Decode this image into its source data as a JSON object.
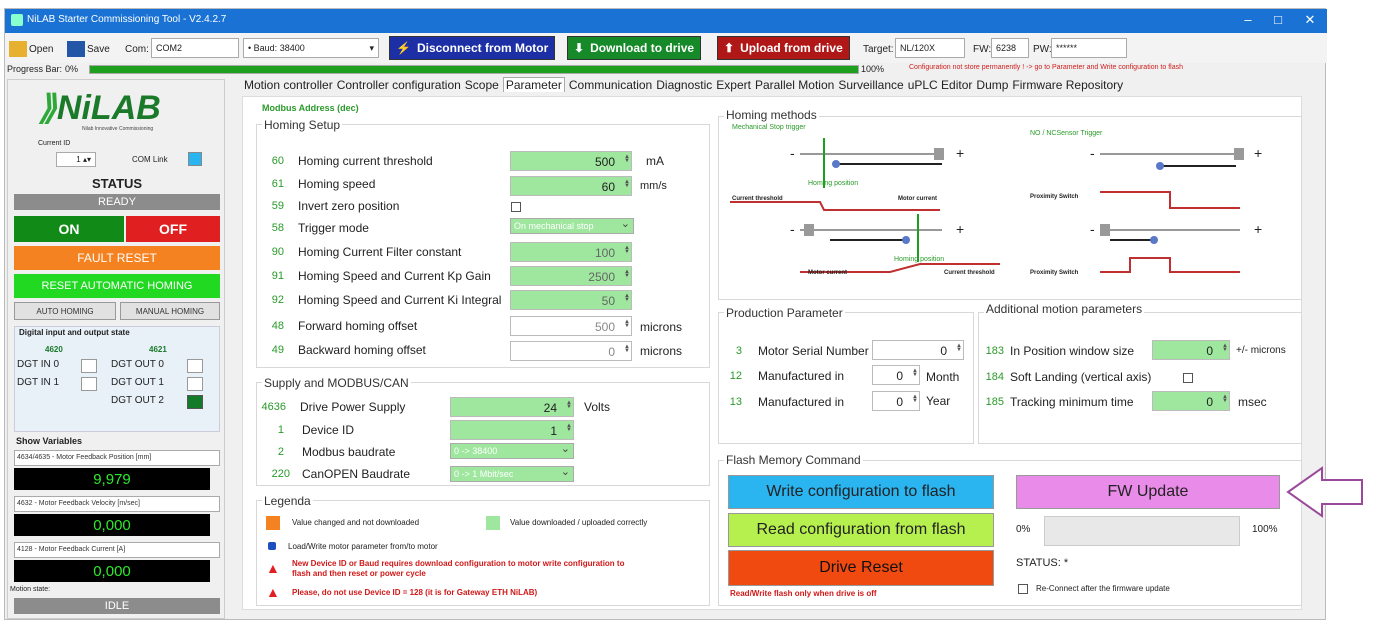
{
  "window": {
    "title": "NiLAB Starter Commissioning Tool - V2.4.2.7"
  },
  "toolbar": {
    "open": "Open",
    "save": "Save",
    "com_label": "Com:",
    "com_value": "COM2",
    "baud_label": "• Baud:",
    "baud_value": "38400",
    "disconnect": "Disconnect from Motor",
    "download": "Download to drive",
    "upload": "Upload from drive",
    "target_label": "Target:",
    "target_value": "NL/120X",
    "fw_label": "FW:",
    "fw_value": "6238",
    "pw_label": "PW:",
    "pw_value": "******"
  },
  "progress": {
    "label": "Progress Bar:",
    "value_text": "0%",
    "end_text": "100%",
    "pct": 100,
    "warning": "Configuration not store permanently ! -> go to Parameter and Write configuration to flash"
  },
  "left": {
    "logo": "NiLAB",
    "logo_sub": "Nilab Innovative Commissioning",
    "current_id_label": "Current ID",
    "current_id": "1",
    "com_link": "COM Link",
    "status_title": "STATUS",
    "status_value": "READY",
    "on": "ON",
    "off": "OFF",
    "fault_reset": "FAULT RESET",
    "reset_homing": "RESET AUTOMATIC HOMING",
    "auto_homing": "AUTO HOMING",
    "manual_homing": "MANUAL HOMING",
    "dio_title": "Digital input and output state",
    "in_num": "4620",
    "out_num": "4621",
    "dgt_in0": "DGT IN 0",
    "dgt_in1": "DGT IN 1",
    "dgt_out0": "DGT OUT 0",
    "dgt_out1": "DGT OUT 1",
    "dgt_out2": "DGT OUT 2",
    "show_vars": "Show Variables",
    "var1_sel": "4634/4635 - Motor Feedback Position [mm]",
    "var1_val": "9,979",
    "var2_sel": "4632 - Motor Feedback Velocity [m/sec]",
    "var2_val": "0,000",
    "var3_sel": "4128 - Motor Feedback Current [A]",
    "var3_val": "0,000",
    "motion_state_label": "Motion state:",
    "motion_state": "IDLE"
  },
  "tabs": [
    "Motion controller",
    "Controller configuration",
    "Scope",
    "Parameter",
    "Communication",
    "Diagnostic",
    "Expert",
    "Parallel Motion",
    "Surveillance",
    "uPLC Editor",
    "Dump",
    "Firmware Repository"
  ],
  "homing": {
    "modbus_addr": "Modbus Address (dec)",
    "title": "Homing Setup",
    "rows": [
      {
        "n": "60",
        "label": "Homing current threshold",
        "value": "500",
        "unit": "mA"
      },
      {
        "n": "61",
        "label": "Homing speed",
        "value": "60",
        "unit": "mm/s"
      },
      {
        "n": "59",
        "label": "Invert zero position"
      },
      {
        "n": "58",
        "label": "Trigger mode",
        "value": "On mechanical stop"
      },
      {
        "n": "90",
        "label": "Homing Current Filter constant",
        "value": "100"
      },
      {
        "n": "91",
        "label": "Homing Speed and Current Kp Gain",
        "value": "2500"
      },
      {
        "n": "92",
        "label": "Homing Speed and Current Ki Integral",
        "value": "50"
      },
      {
        "n": "48",
        "label": "Forward homing offset",
        "value": "500",
        "unit": "microns"
      },
      {
        "n": "49",
        "label": "Backward homing offset",
        "value": "0",
        "unit": "microns"
      }
    ]
  },
  "supply": {
    "title": "Supply and MODBUS/CAN",
    "rows": [
      {
        "n": "4636",
        "label": "Drive Power Supply",
        "value": "24",
        "unit": "Volts"
      },
      {
        "n": "1",
        "label": "Device ID",
        "value": "1"
      },
      {
        "n": "2",
        "label": "Modbus baudrate",
        "value": "0 -> 38400"
      },
      {
        "n": "220",
        "label": "CanOPEN Baudrate",
        "value": "0 -> 1 Mbit/sec"
      }
    ]
  },
  "legend": {
    "title": "Legenda",
    "changed": "Value changed and not downloaded",
    "downloaded": "Value downloaded / uploaded correctly",
    "loadwrite": "Load/Write motor parameter from/to motor",
    "warn1": "New Device ID or Baud requires download configuration to motor write configuration to flash and then reset or power cycle",
    "warn2": "Please, do not use Device ID = 128 (it is for Gateway ETH NiLAB)"
  },
  "homing_methods": {
    "title": "Homing methods",
    "mech": "Mechanical Stop trigger",
    "sensor": "NO / NCSensor Trigger",
    "current_threshold": "Current threshold",
    "motor_current": "Motor current",
    "homing_position": "Homing position",
    "proximity": "Proximity Switch"
  },
  "production": {
    "title": "Production Parameter",
    "rows": [
      {
        "n": "3",
        "label": "Motor Serial Number",
        "value": "0"
      },
      {
        "n": "12",
        "label": "Manufactured in",
        "value": "0",
        "unit": "Month"
      },
      {
        "n": "13",
        "label": "Manufactured in",
        "value": "0",
        "unit": "Year"
      }
    ]
  },
  "additional": {
    "title": "Additional motion parameters",
    "rows": [
      {
        "n": "183",
        "label": "In Position window size",
        "value": "0",
        "unit": "+/- microns"
      },
      {
        "n": "184",
        "label": "Soft Landing (vertical axis)"
      },
      {
        "n": "185",
        "label": "Tracking minimum time",
        "value": "0",
        "unit": "msec"
      }
    ]
  },
  "flash": {
    "title": "Flash Memory Command",
    "write": "Write configuration to flash",
    "read": "Read configuration from flash",
    "reset": "Drive Reset",
    "note": "Read/Write flash only when drive is off",
    "fw_update": "FW Update",
    "pct0": "0%",
    "pct100": "100%",
    "status": "STATUS: *",
    "reconnect": "Re-Connect after the firmware update"
  },
  "colors": {
    "accent": "#1a73d4",
    "green": "#9fe79f",
    "red": "#e02020",
    "orange": "#f58220",
    "cyan": "#2ab4f0",
    "lime": "#b6f04e",
    "pink": "#e98be9"
  }
}
